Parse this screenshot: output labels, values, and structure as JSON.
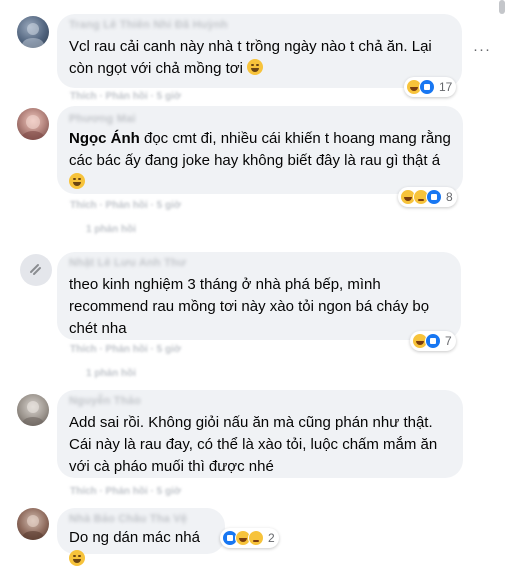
{
  "comments": [
    {
      "author": "Trang Lê Thiên Nhi Đã Huỳnh",
      "text": "Vcl rau cải canh này nhà t trồng ngày nào t chả ăn. Lại còn ngọt với chả mồng tơi",
      "reaction_count": "17",
      "meta": "Thích · Phản hồi · 5 giờ"
    },
    {
      "author": "Phương Mai",
      "mention": "Ngọc Ánh",
      "text": "đọc cmt đi, nhiều cái khiến t hoang mang rằng các bác ấy đang joke hay không biết đây là rau gì thật á",
      "reaction_count": "8",
      "meta": "Thích · Phản hồi · 5 giờ",
      "sub_meta": "1 phản hồi"
    },
    {
      "author": "Nhật Lê Lưu Anh Thư",
      "text": "theo kinh nghiệm 3 tháng ở nhà phá bếp, mình recommend rau mồng tơi này xào tỏi ngon bá cháy bọ chét nha",
      "reaction_count": "7",
      "meta": "Thích · Phản hồi · 5 giờ",
      "sub_meta": "1 phản hồi"
    },
    {
      "author": "Nguyễn Thảo",
      "text": "Add sai rồi. Không giỏi nấu ăn mà cũng phán như thật. Cái này là rau đay, có thể là xào tỏi, luộc chấm mắm ăn với cà pháo muối thì được nhé",
      "meta": "Thích · Phản hồi · 5 giờ"
    },
    {
      "author": "Nhà Bảo Châu Tha Vệ",
      "text": "Do ng dán mác nhá",
      "reaction_count": "2"
    }
  ],
  "icons": {
    "more": "more-options-icon",
    "reaction_haha": "haha-reaction-icon",
    "reaction_like": "like-reaction-icon",
    "reaction_sad": "sad-reaction-icon"
  },
  "colors": {
    "bubble": "#f0f2f5",
    "like_blue": "#1877f2",
    "emoji_yellow": "#f7c33b",
    "secondary_text": "#65676b"
  }
}
